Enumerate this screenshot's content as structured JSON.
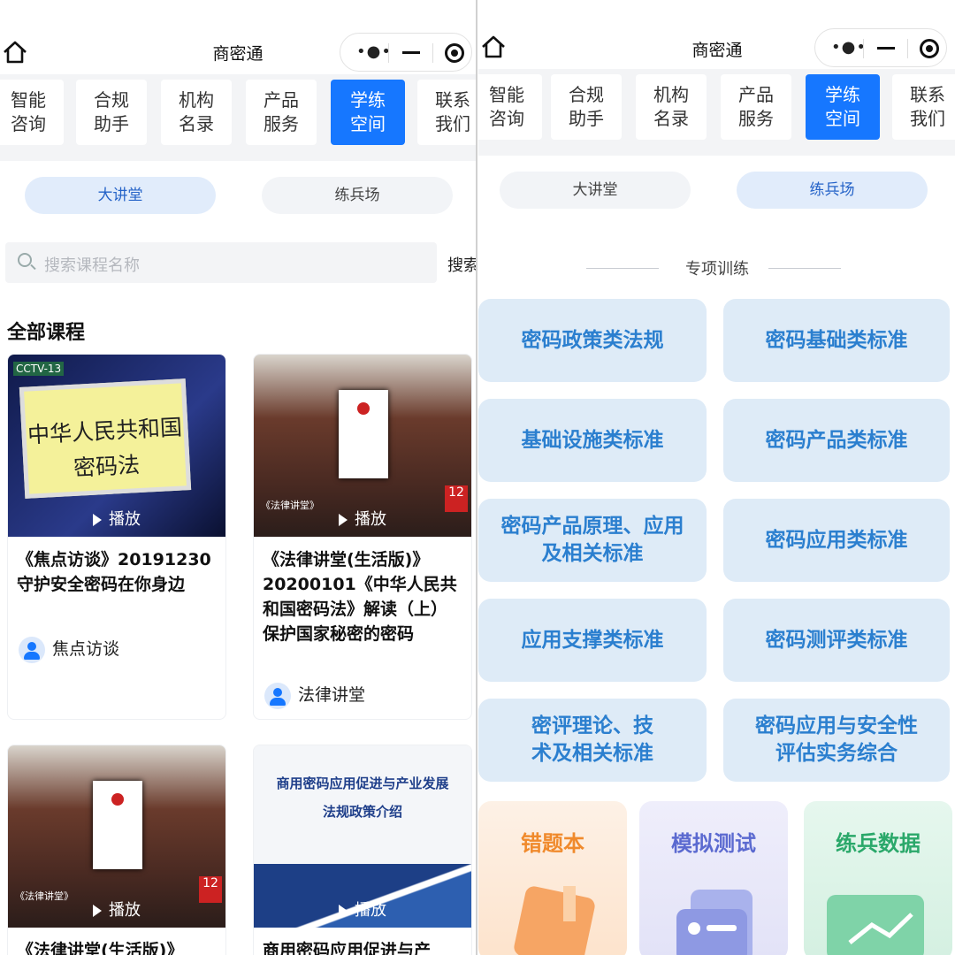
{
  "app_title": "商密通",
  "capsule": {
    "more_label": "•●•"
  },
  "tabs": [
    {
      "line1": "智能",
      "line2": "咨询"
    },
    {
      "line1": "合规",
      "line2": "助手"
    },
    {
      "line1": "机构",
      "line2": "名录"
    },
    {
      "line1": "产品",
      "line2": "服务"
    },
    {
      "line1": "学练",
      "line2": "空间"
    },
    {
      "line1": "联系",
      "line2": "我们"
    }
  ],
  "active_tab_index": 4,
  "subtabs": [
    "大讲堂",
    "练兵场"
  ],
  "left": {
    "active_subtab": "大讲堂",
    "search": {
      "placeholder": "搜索课程名称",
      "button": "搜索"
    },
    "section_title": "全部课程",
    "play_label": "播放",
    "courses": [
      {
        "title": "《焦点访谈》20191230守护安全密码在你身边",
        "author": "焦点访谈",
        "poster_text": [
          "中华人民共和国",
          "密码法"
        ],
        "channel": "CCTV-13"
      },
      {
        "title": "《法律讲堂(生活版)》20200101《中华人民共和国密码法》解读（上）保护国家秘密的密码",
        "author": "法律讲堂",
        "poster_text": [
          "《法律讲堂》"
        ],
        "channel": "12"
      },
      {
        "title": "《法律讲堂(生活版)》",
        "author": "",
        "poster_text": [
          "《法律讲堂》"
        ],
        "channel": "12"
      },
      {
        "title": "商用密码应用促进与产",
        "author": "",
        "poster_text": [
          "商用密码应用促进与产业发展",
          "法规政策介绍"
        ],
        "channel": ""
      }
    ]
  },
  "right": {
    "active_subtab": "练兵场",
    "section_title": "专项训练",
    "training_items": [
      "密码政策类法规",
      "密码基础类标准",
      "基础设施类标准",
      "密码产品类标准",
      "密码产品原理、应用及相关标准",
      "密码应用类标准",
      "应用支撑类标准",
      "密码测评类标准",
      "密评理论、技术及相关标准",
      "密码应用与安全性评估实务综合"
    ],
    "tiles": [
      {
        "label": "错题本",
        "color": "#f08a2c"
      },
      {
        "label": "模拟测试",
        "color": "#5b6ad0"
      },
      {
        "label": "练兵数据",
        "color": "#2aa86a"
      }
    ]
  },
  "colors": {
    "accent": "#1677ff",
    "training_bg": "#deebf7",
    "training_text": "#2b7fcf"
  }
}
